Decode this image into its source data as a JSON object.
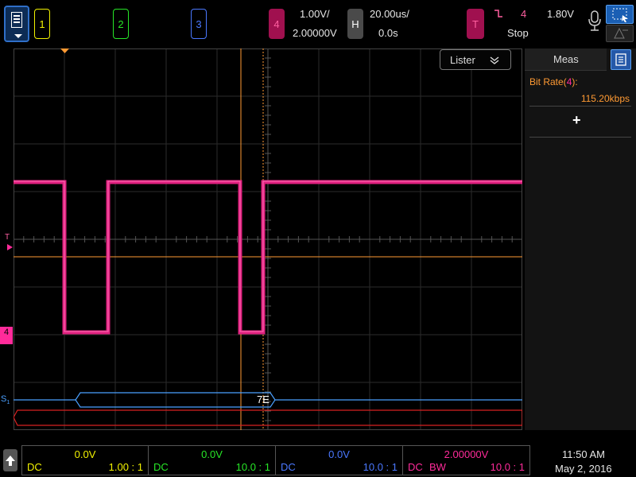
{
  "toolbar": {
    "ch1": "1",
    "ch2": "2",
    "ch3": "3",
    "ch4": "4",
    "ch4_scale": "1.00V/",
    "ch4_offset": "2.00000V",
    "horiz_label": "H",
    "time_scale": "20.00us/",
    "time_delay": "0.0s",
    "trigger_label": "T",
    "trigger_source": "4",
    "trigger_level": "1.80V",
    "run_state": "Stop"
  },
  "screen": {
    "lister_label": "Lister",
    "trigger_marker": "T",
    "ch4_marker": "4",
    "serial_marker": "S",
    "serial_marker_sub": "1",
    "decode_value": "7E"
  },
  "meas_panel": {
    "tab_label": "Meas",
    "meas_name_prefix": "Bit Rate(",
    "meas_source": "4",
    "meas_name_suffix": "):",
    "meas_value": "115.20kbps",
    "add_label": "+"
  },
  "channels_status": [
    {
      "offset": "0.0V",
      "coupling": "DC",
      "bw": "",
      "probe": "1.00 : 1",
      "color": "#f2f200"
    },
    {
      "offset": "0.0V",
      "coupling": "DC",
      "bw": "",
      "probe": "10.0 : 1",
      "color": "#27e627"
    },
    {
      "offset": "0.0V",
      "coupling": "DC",
      "bw": "",
      "probe": "10.0 : 1",
      "color": "#4a78ff"
    },
    {
      "offset": "2.00000V",
      "coupling": "DC",
      "bw": "BW",
      "probe": "10.0 : 1",
      "color": "#ff2b9a"
    }
  ],
  "clock": {
    "time": "11:50 AM",
    "date": "May 2, 2016"
  },
  "colors": {
    "ch1": "#f2f200",
    "ch2": "#27e627",
    "ch3": "#4a78ff",
    "ch4": "#ff2b9a",
    "cursor": "#ff9a33",
    "serial": "#4aa0ff",
    "trigger": "#ff5fa0"
  },
  "icons": {
    "menu": "menu-icon",
    "mic": "microphone-icon",
    "zoom": "zoom-box-icon",
    "home": "up-arrow-icon",
    "chevron": "chevron-down-icon"
  }
}
